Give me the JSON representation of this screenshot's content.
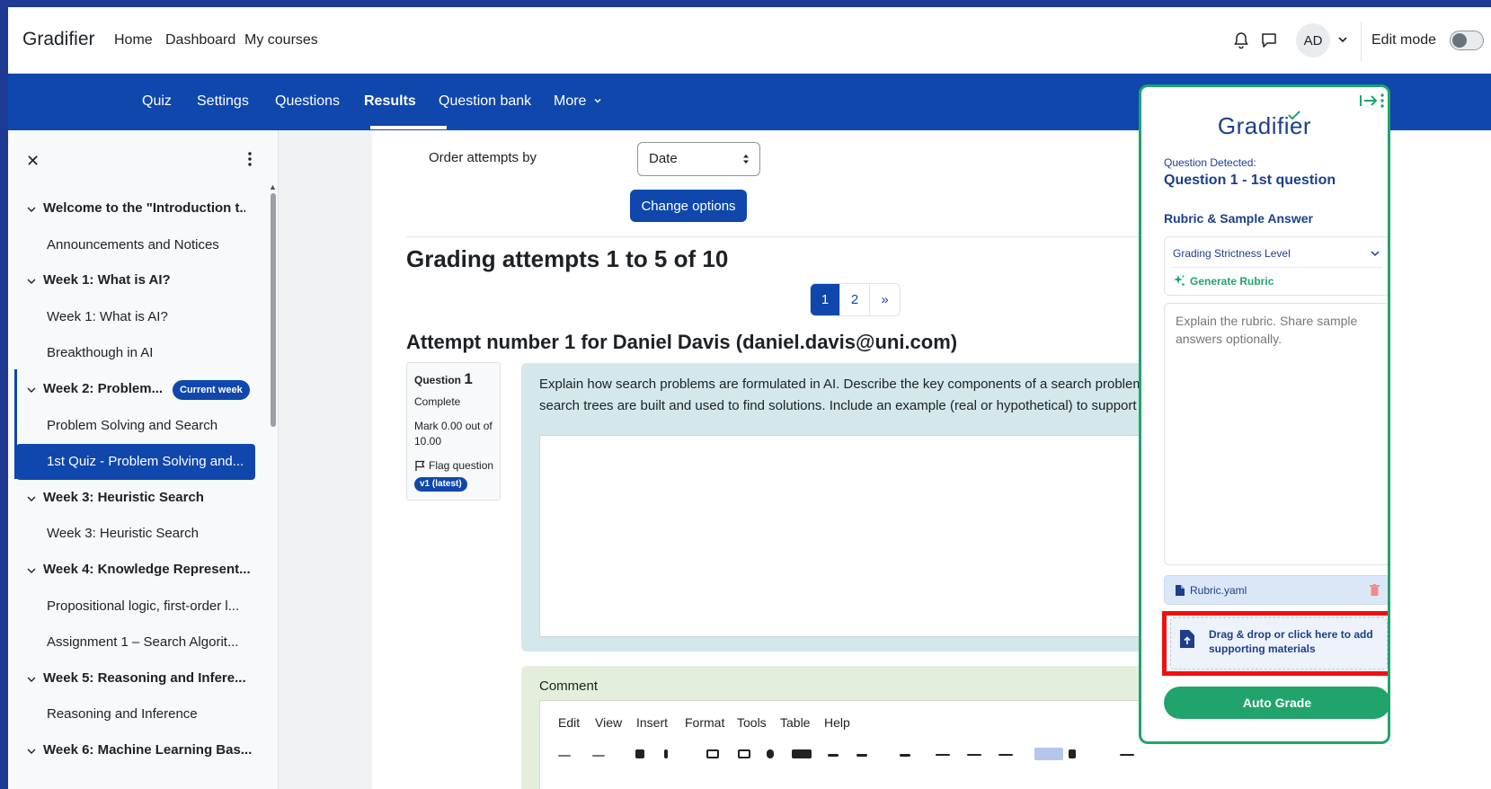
{
  "topbar": {
    "brand": "Gradifier",
    "nav": [
      "Home",
      "Dashboard",
      "My courses"
    ],
    "avatar_initials": "AD",
    "edit_mode_label": "Edit mode",
    "icons": {
      "notifications": "bell-icon",
      "messages": "chat-icon"
    }
  },
  "secondary_nav": {
    "items": [
      "Quiz",
      "Settings",
      "Questions",
      "Results",
      "Question bank",
      "More"
    ],
    "active": "Results"
  },
  "drawer": {
    "close": "✕",
    "current_week_badge": "Current week",
    "entries": [
      {
        "type": "section",
        "label": "Welcome to the \"Introduction t..."
      },
      {
        "type": "item",
        "label": "Announcements and Notices"
      },
      {
        "type": "section",
        "label": "Week 1: What is AI?"
      },
      {
        "type": "item",
        "label": "Week 1: What is AI?"
      },
      {
        "type": "item",
        "label": "Breakthough in AI"
      },
      {
        "type": "section",
        "label": "Week 2: Problem..."
      },
      {
        "type": "item",
        "label": "Problem Solving and Search"
      },
      {
        "type": "item",
        "label": "1st Quiz - Problem Solving and..."
      },
      {
        "type": "section",
        "label": "Week 3: Heuristic Search"
      },
      {
        "type": "item",
        "label": "Week 3: Heuristic Search"
      },
      {
        "type": "section",
        "label": "Week 4: Knowledge Represent..."
      },
      {
        "type": "item",
        "label": "Propositional logic, first-order l..."
      },
      {
        "type": "item",
        "label": "Assignment 1 – Search Algorit..."
      },
      {
        "type": "section",
        "label": "Week 5: Reasoning and Infere..."
      },
      {
        "type": "item",
        "label": "Reasoning and Inference"
      },
      {
        "type": "section",
        "label": "Week 6: Machine Learning Bas..."
      }
    ]
  },
  "main": {
    "order_label": "Order attempts by",
    "order_value": "Date",
    "change_button": "Change options",
    "grading_title": "Grading attempts 1 to 5 of 10",
    "pagination": [
      "1",
      "2",
      "»"
    ],
    "attempt_title": "Attempt number 1 for Daniel Davis (daniel.davis@uni.com)",
    "question_info": {
      "label": "Question",
      "number": "1",
      "status": "Complete",
      "mark": "Mark 0.00 out of 10.00",
      "flag": "Flag question",
      "version": "v1 (latest)"
    },
    "question_text_line1": "Explain how search problems are formulated in AI. Describe the key components of a search problem",
    "question_text_line2": "search trees are built and used to find solutions. Include an example (real or hypothetical) to support",
    "comment_label": "Comment",
    "editor_menu": [
      "Edit",
      "View",
      "Insert",
      "Format",
      "Tools",
      "Table",
      "Help"
    ]
  },
  "panel": {
    "logo": "Gradifier",
    "question_detected_label": "Question Detected:",
    "question_detected_value": "Question 1 - 1st question",
    "rubric_heading": "Rubric & Sample Answer",
    "strictness_label": "Grading Strictness Level",
    "generate_rubric": "Generate Rubric",
    "rubric_placeholder": "Explain the rubric. Share sample answers optionally.",
    "file_name": "Rubric.yaml",
    "drop_text": "Drag & drop or click here to add supporting materials",
    "auto_grade": "Auto Grade",
    "colors": {
      "accent": "#20a46c",
      "navy": "#1d3f8a",
      "highlight": "#ee1111"
    }
  }
}
